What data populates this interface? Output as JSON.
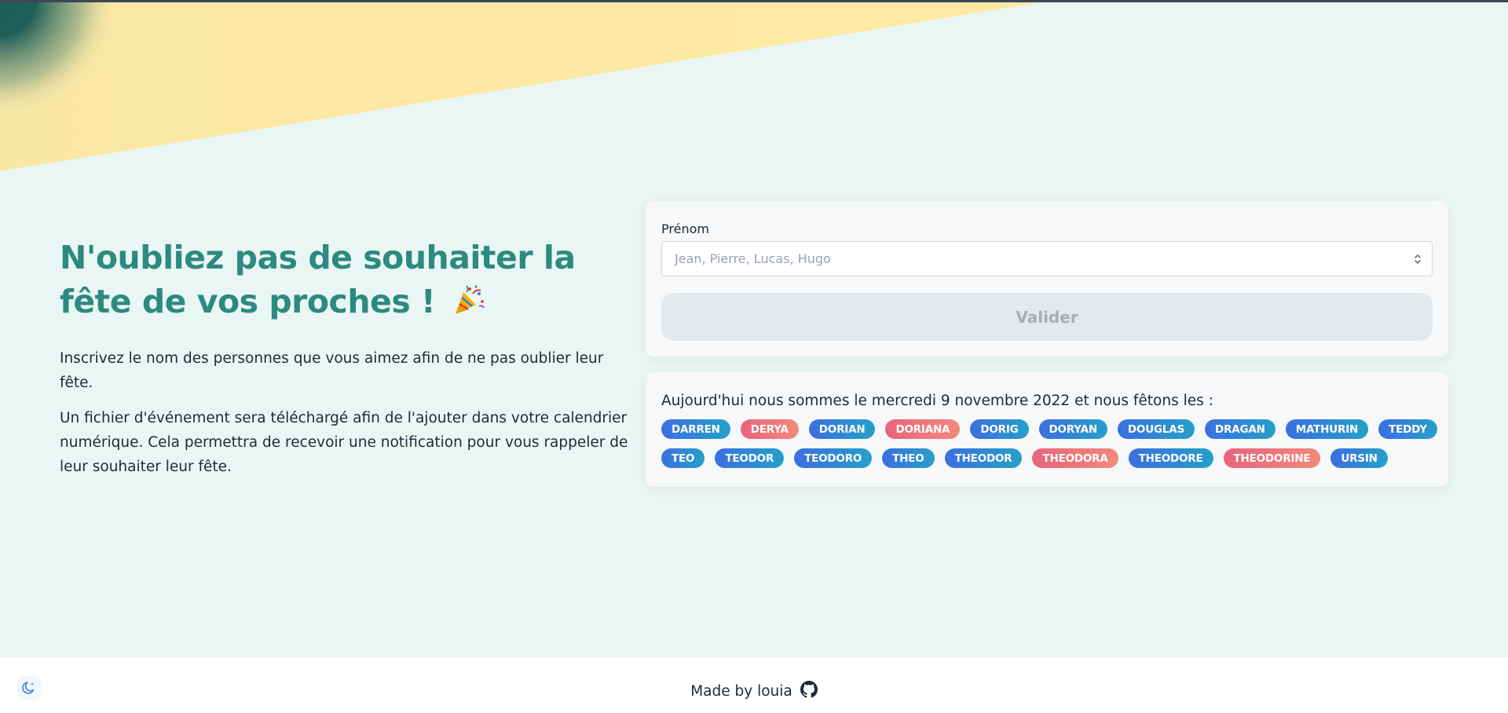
{
  "hero": {
    "title": "N'oubliez pas de souhaiter la fête de vos proches !",
    "intro": "Inscrivez le nom des personnes que vous aimez afin de ne pas oublier leur fête.",
    "description": "Un fichier d'événement sera téléchargé afin de l'ajouter dans votre calendrier numérique. Cela permettra de recevoir une notification pour vous rappeler de leur souhaiter leur fête."
  },
  "form": {
    "label": "Prénom",
    "placeholder": "Jean, Pierre, Lucas, Hugo",
    "submit_label": "Valider"
  },
  "today": {
    "text": "Aujourd'hui nous sommes le mercredi 9 novembre 2022 et nous fêtons les :",
    "names": [
      {
        "name": "DARREN",
        "gender": "m"
      },
      {
        "name": "DERYA",
        "gender": "f"
      },
      {
        "name": "DORIAN",
        "gender": "m"
      },
      {
        "name": "DORIANA",
        "gender": "f"
      },
      {
        "name": "DORIG",
        "gender": "m"
      },
      {
        "name": "DORYAN",
        "gender": "m"
      },
      {
        "name": "DOUGLAS",
        "gender": "m"
      },
      {
        "name": "DRAGAN",
        "gender": "m"
      },
      {
        "name": "MATHURIN",
        "gender": "m"
      },
      {
        "name": "TEDDY",
        "gender": "m"
      },
      {
        "name": "TEO",
        "gender": "m"
      },
      {
        "name": "TEODOR",
        "gender": "m"
      },
      {
        "name": "TEODORO",
        "gender": "m"
      },
      {
        "name": "THEO",
        "gender": "m"
      },
      {
        "name": "THEODOR",
        "gender": "m"
      },
      {
        "name": "THEODORA",
        "gender": "f"
      },
      {
        "name": "THEODORE",
        "gender": "m"
      },
      {
        "name": "THEODORINE",
        "gender": "f"
      },
      {
        "name": "URSIN",
        "gender": "m"
      }
    ]
  },
  "footer": {
    "made_by": "Made by louia"
  },
  "icons": {
    "party": "party-popper-icon",
    "theme": "moon-sparkle-icon",
    "github": "github-icon",
    "select": "chevron-up-down-icon"
  },
  "colors": {
    "title": "#2c8a80",
    "background": "#eaf6f4",
    "male_tag_start": "#3b6fe0",
    "male_tag_end": "#26a0c9",
    "female_tag_start": "#e8647e",
    "female_tag_end": "#f08a7b",
    "banner_yellow": "#fde9a4",
    "banner_teal": "#1e5c58"
  }
}
